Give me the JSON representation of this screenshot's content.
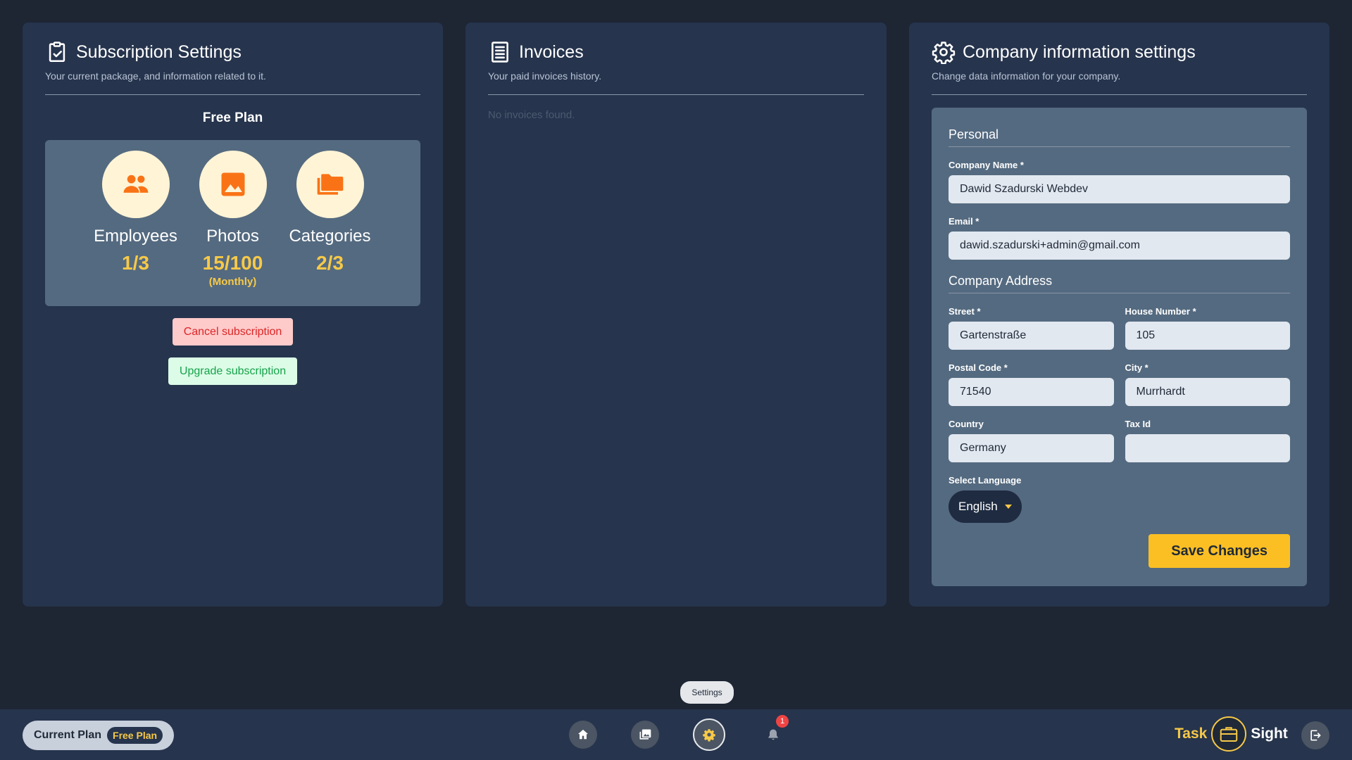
{
  "subscription": {
    "title": "Subscription Settings",
    "subtitle": "Your current package, and information related to it.",
    "plan_name": "Free Plan",
    "stats": [
      {
        "label": "Employees",
        "value": "1/3",
        "icon": "people-icon"
      },
      {
        "label": "Photos",
        "value": "15/100",
        "sub": "(Monthly)",
        "icon": "image-icon"
      },
      {
        "label": "Categories",
        "value": "2/3",
        "icon": "folders-icon"
      }
    ],
    "cancel_label": "Cancel subscription",
    "upgrade_label": "Upgrade subscription"
  },
  "invoices": {
    "title": "Invoices",
    "subtitle": "Your paid invoices history.",
    "empty_text": "No invoices found."
  },
  "company": {
    "title": "Company information settings",
    "subtitle": "Change data information for your company.",
    "personal_title": "Personal",
    "company_name_label": "Company Name *",
    "company_name_value": "Dawid Szadurski Webdev",
    "email_label": "Email *",
    "email_value": "dawid.szadurski+admin@gmail.com",
    "address_title": "Company Address",
    "street_label": "Street *",
    "street_value": "Gartenstraße",
    "house_label": "House Number *",
    "house_value": "105",
    "postal_label": "Postal Code *",
    "postal_value": "71540",
    "city_label": "City *",
    "city_value": "Murrhardt",
    "country_label": "Country",
    "country_value": "Germany",
    "taxid_label": "Tax Id",
    "taxid_value": "",
    "language_label": "Select Language",
    "language_value": "English",
    "save_label": "Save Changes"
  },
  "tooltip": "Settings",
  "bottombar": {
    "current_plan_label": "Current Plan",
    "current_plan_value": "Free Plan",
    "notifications_count": "1",
    "brand_left": "Task",
    "brand_right": "Sight"
  },
  "colors": {
    "accent": "#f7c948",
    "icon_orange": "#f97316",
    "panel": "#26344d",
    "background": "#1e2533"
  }
}
